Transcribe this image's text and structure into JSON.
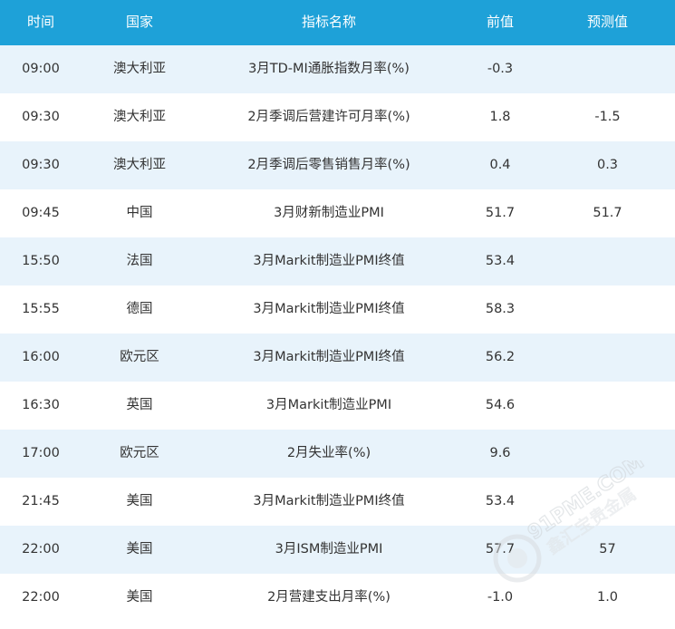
{
  "header": {
    "time": "时间",
    "country": "国家",
    "indicator": "指标名称",
    "previous": "前值",
    "forecast": "预测值"
  },
  "rows": [
    {
      "time": "09:00",
      "country": "澳大利亚",
      "indicator": "3月TD-MI通胀指数月率(%)",
      "previous": "-0.3",
      "forecast": ""
    },
    {
      "time": "09:30",
      "country": "澳大利亚",
      "indicator": "2月季调后营建许可月率(%)",
      "previous": "1.8",
      "forecast": "-1.5"
    },
    {
      "time": "09:30",
      "country": "澳大利亚",
      "indicator": "2月季调后零售销售月率(%)",
      "previous": "0.4",
      "forecast": "0.3"
    },
    {
      "time": "09:45",
      "country": "中国",
      "indicator": "3月财新制造业PMI",
      "previous": "51.7",
      "forecast": "51.7"
    },
    {
      "time": "15:50",
      "country": "法国",
      "indicator": "3月Markit制造业PMI终值",
      "previous": "53.4",
      "forecast": ""
    },
    {
      "time": "15:55",
      "country": "德国",
      "indicator": "3月Markit制造业PMI终值",
      "previous": "58.3",
      "forecast": ""
    },
    {
      "time": "16:00",
      "country": "欧元区",
      "indicator": "3月Markit制造业PMI终值",
      "previous": "56.2",
      "forecast": ""
    },
    {
      "time": "16:30",
      "country": "英国",
      "indicator": "3月Markit制造业PMI",
      "previous": "54.6",
      "forecast": ""
    },
    {
      "time": "17:00",
      "country": "欧元区",
      "indicator": "2月失业率(%)",
      "previous": "9.6",
      "forecast": ""
    },
    {
      "time": "21:45",
      "country": "美国",
      "indicator": "3月Markit制造业PMI终值",
      "previous": "53.4",
      "forecast": ""
    },
    {
      "time": "22:00",
      "country": "美国",
      "indicator": "3月ISM制造业PMI",
      "previous": "57.7",
      "forecast": "57"
    },
    {
      "time": "22:00",
      "country": "美国",
      "indicator": "2月营建支出月率(%)",
      "previous": "-1.0",
      "forecast": "1.0"
    }
  ],
  "watermark": {
    "brand": "91PME.COM",
    "tagline": "鑫汇宝贵金属"
  },
  "colors": {
    "header_bg": "#1ea1d8",
    "row_alt_bg": "#e8f3fb",
    "text": "#333333"
  }
}
